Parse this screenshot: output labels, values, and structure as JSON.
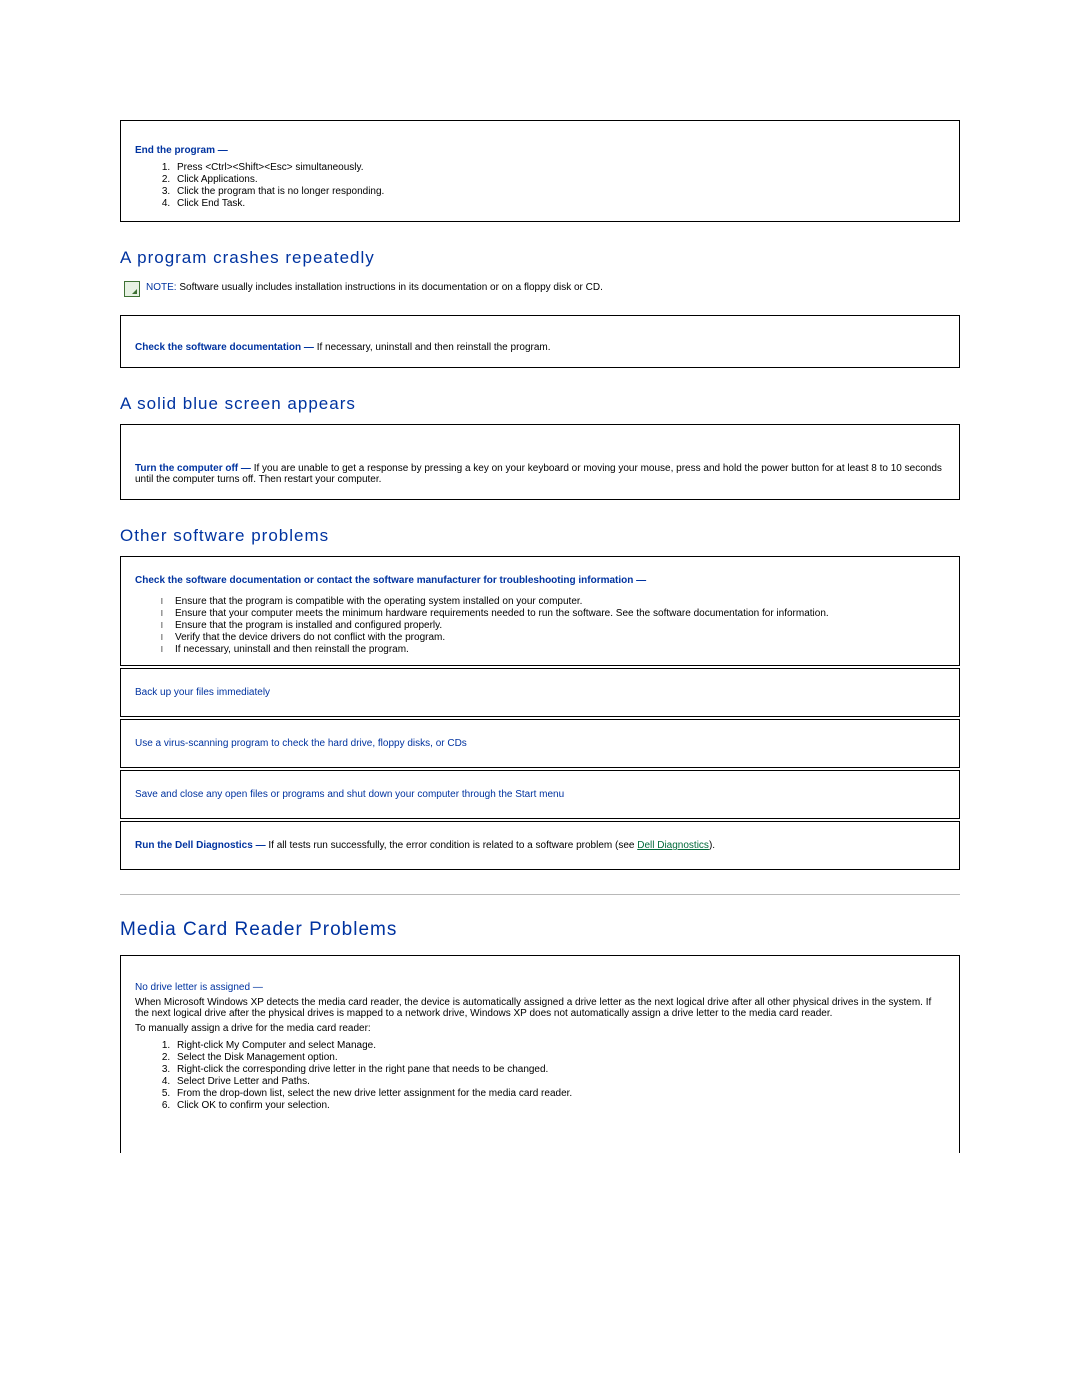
{
  "endProgram": {
    "title": "End the program —",
    "steps": [
      "Press <Ctrl><Shift><Esc> simultaneously.",
      "Click Applications.",
      "Click the program that is no longer responding.",
      "Click End Task."
    ]
  },
  "crashes": {
    "heading": "A program crashes repeatedly",
    "noteLabel": "NOTE:",
    "noteText": " Software usually includes installation instructions in its documentation or on a floppy disk or CD.",
    "boxLead": "Check the software documentation —",
    "boxRest": " If necessary, uninstall and then reinstall the program."
  },
  "blueScreen": {
    "heading": "A solid blue screen appears",
    "boxLead": "Turn the computer off —",
    "boxRest": " If you are unable to get a response by pressing a key on your keyboard or moving your mouse, press and hold the power button for at least 8 to 10 seconds until the computer turns off. Then restart your computer."
  },
  "otherSoft": {
    "heading": "Other software problems",
    "lead": "Check the software documentation or contact the software manufacturer for troubleshooting information —",
    "bullets": [
      "Ensure that the program is compatible with the operating system installed on your computer.",
      "Ensure that your computer meets the minimum hardware requirements needed to run the software. See the software documentation for information.",
      "Ensure that the program is installed and configured properly.",
      "Verify that the device drivers do not conflict with the program.",
      "If necessary, uninstall and then reinstall the program."
    ],
    "row2": "Back up your files immediately",
    "row3": "Use a virus-scanning program to check the hard drive, floppy disks, or CDs",
    "row4": "Save and close any open files or programs and shut down your computer through the Start menu",
    "row5Lead": "Run the Dell Diagnostics —",
    "row5Rest": " If all tests run successfully, the error condition is related to a software problem (see ",
    "row5Link": "Dell Diagnostics",
    "row5End": ")."
  },
  "media": {
    "heading": "Media Card Reader Problems",
    "sub": "No drive letter is assigned —",
    "para1": "When Microsoft Windows XP detects the media card reader, the device is automatically assigned a drive letter as the next logical drive after all other physical drives in the system. If the next logical drive after the physical drives is mapped to a network drive, Windows XP does not automatically assign a drive letter to the media card reader.",
    "para2": "To manually assign a drive for the media card reader:",
    "steps": [
      "Right-click My Computer and select Manage.",
      "Select the Disk Management option.",
      "Right-click the corresponding drive letter in the right pane that needs to be changed.",
      "Select Drive Letter and Paths.",
      "From the drop-down list, select the new drive letter assignment for the media card reader.",
      "Click OK to confirm your selection."
    ]
  }
}
